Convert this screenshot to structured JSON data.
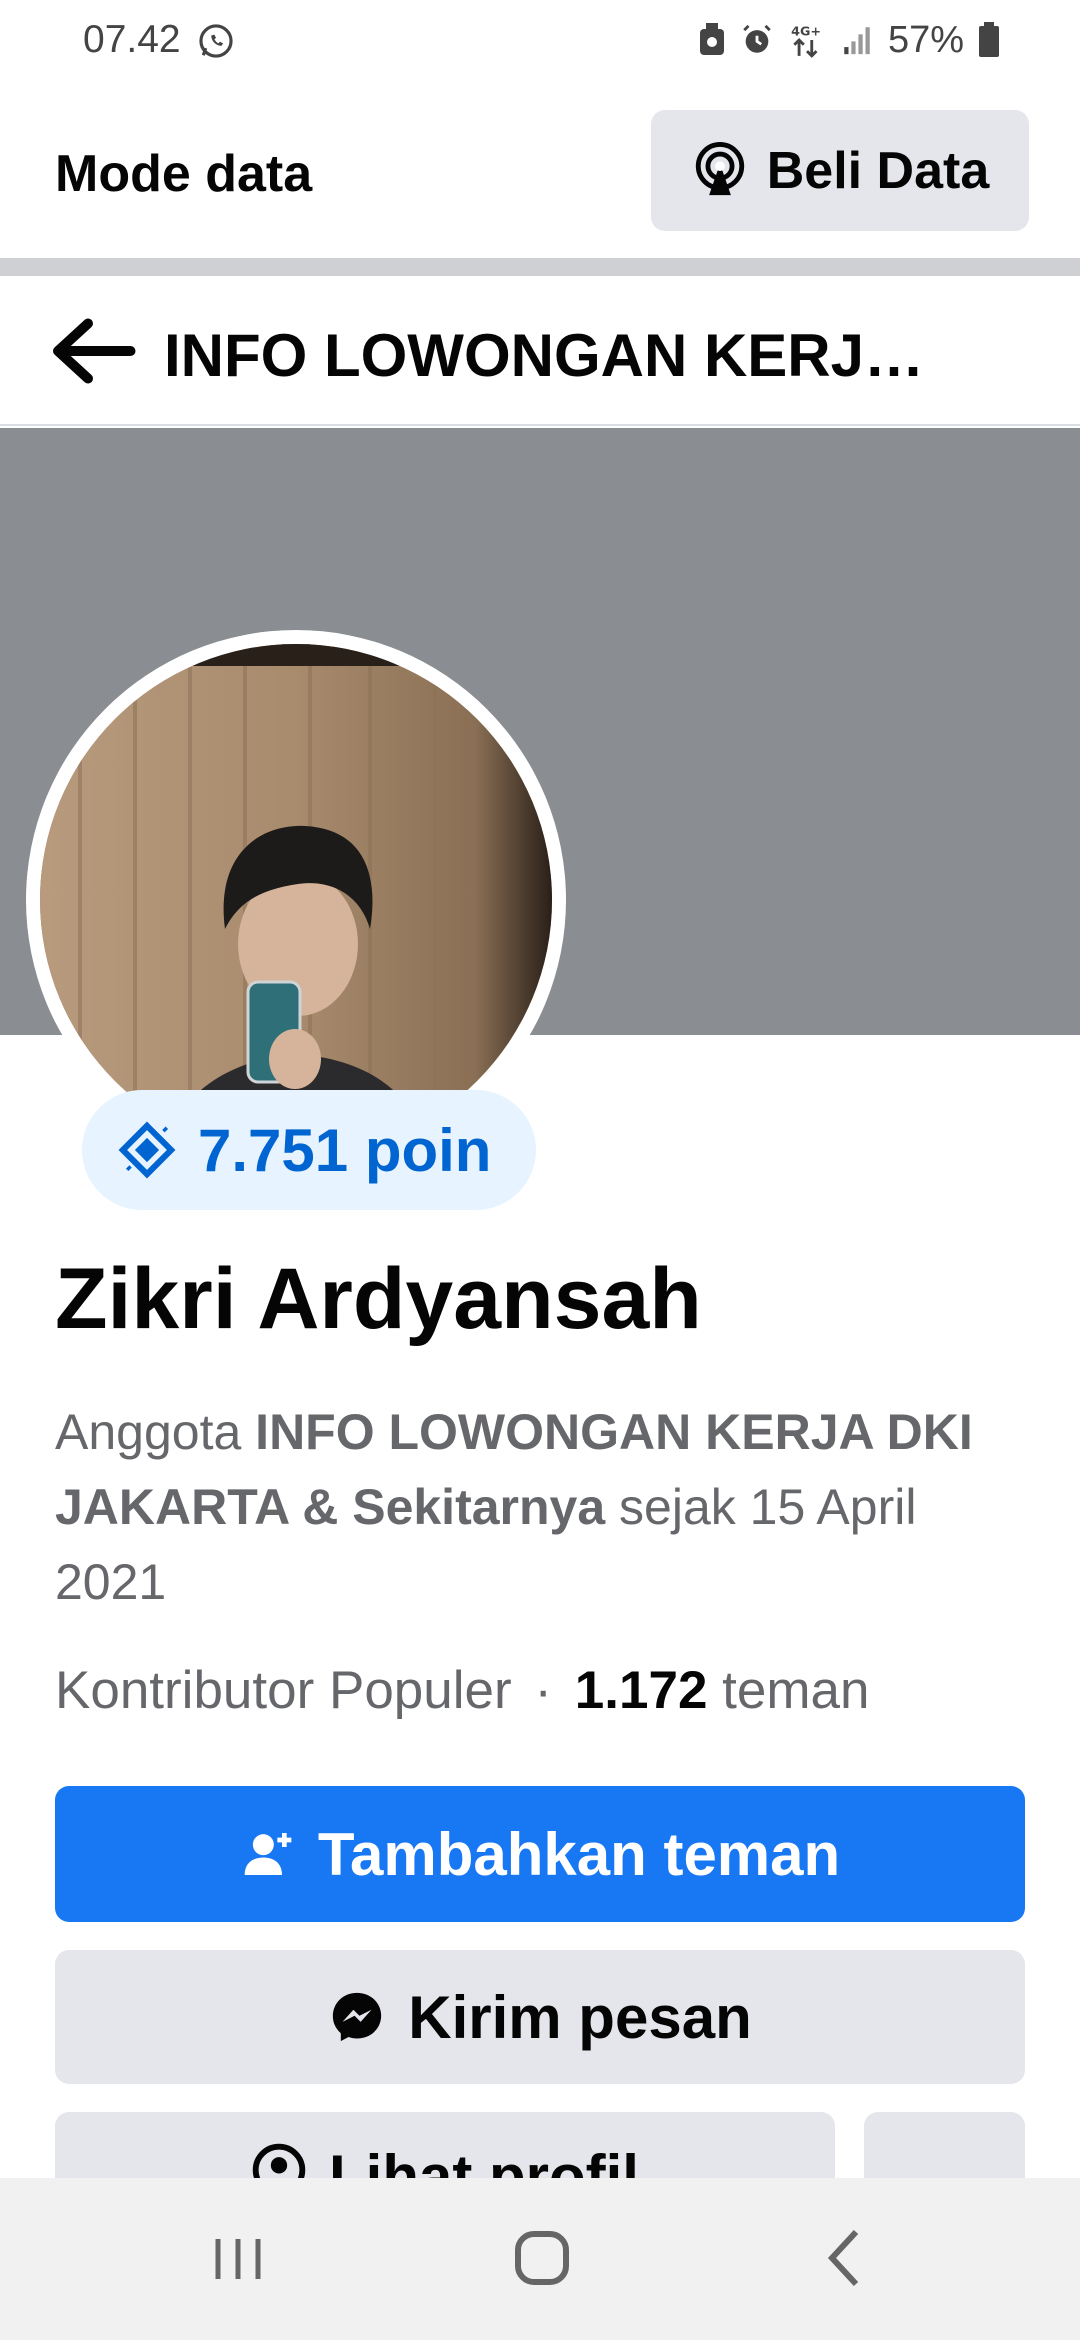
{
  "status_bar": {
    "time": "07.42",
    "network": "4G+",
    "battery": "57%"
  },
  "data_bar": {
    "title": "Mode data",
    "buy_label": "Beli Data"
  },
  "header": {
    "title": "INFO LOWONGAN KERJ…"
  },
  "profile": {
    "points": "7.751 poin",
    "name": "Zikri Ardyansah",
    "member_prefix": "Anggota ",
    "group_name": "INFO LOWONGAN KERJA DKI JAKARTA & Sekitarnya",
    "member_suffix": " sejak 15 April 2021",
    "role": "Kontributor Populer",
    "separator": "·",
    "friends_count": "1.172",
    "friends_label": "teman"
  },
  "actions": {
    "add_friend": "Tambahkan teman",
    "send_message": "Kirim pesan",
    "view_profile": "Lihat profil",
    "more": "···"
  },
  "colors": {
    "primary": "#1877f2",
    "points_text": "#0064d1",
    "points_bg": "#e7f3ff",
    "cover": "#8a8d91",
    "button_gray": "#e4e6eb"
  }
}
